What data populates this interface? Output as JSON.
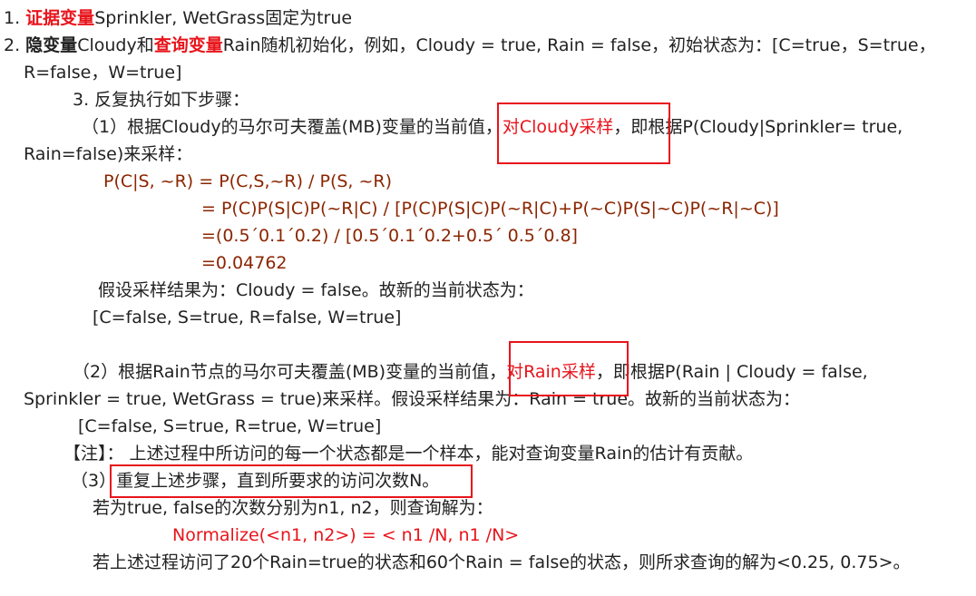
{
  "item1": {
    "num": "1. ",
    "label": "证据变量",
    "text": "Sprinkler, WetGrass固定为true"
  },
  "item2": {
    "num": "2. ",
    "label1": "隐变量",
    "mid": "Cloudy和",
    "label2": "查询变量",
    "text": "Rain随机初始化，例如，Cloudy = true, Rain = false，初始状态为：[C=true，S=true，",
    "cont": "R=false，W=true]"
  },
  "step3": "3. 反复执行如下步骤：",
  "sub1": {
    "prefix": "（1）根据Cloudy的马尔可夫覆盖(MB)变量的当前值，",
    "highlight": "对Cloudy采样",
    "suffix": "，即根据P(Cloudy|Sprinkler= true,",
    "cont": "Rain=false)来采样："
  },
  "formula": {
    "line1": "P(C|S, ~R) = P(C,S,~R) / P(S, ~R)",
    "line2": "= P(C)P(S|C)P(~R|C) / [P(C)P(S|C)P(~R|C)+P(~C)P(S|~C)P(~R|~C)]",
    "line3": "=(0.5´0.1´0.2) / [0.5´0.1´0.2+0.5´ 0.5´0.8]",
    "line4": "=0.04762"
  },
  "assume1": "假设采样结果为：Cloudy = false。故新的当前状态为：",
  "state1": "[C=false, S=true, R=false, W=true]",
  "sub2": {
    "prefix": "（2）根据Rain节点的马尔可夫覆盖(MB)变量的当前值，",
    "highlight": "对Rain采样",
    "suffix": "，即根据P(Rain | Cloudy = false,",
    "cont": "Sprinkler = true, WetGrass = true)来采样。假设采样结果为：Rain = true。故新的当前状态为："
  },
  "state2": "[C=false, S=true, R=true, W=true]",
  "note": "【注】：  上述过程中所访问的每一个状态都是一个样本，能对查询变量Rain的估计有贡献。",
  "sub3": "（3）重复上述步骤，直到所要求的访问次数N。",
  "counts": "若为true, false的次数分别为n1, n2，则查询解为：",
  "normalize": "Normalize(<n1, n2>) = < n1 /N, n1 /N>",
  "conclusion": "若上述过程访问了20个Rain=true的状态和60个Rain = false的状态，则所求查询的解为<0.25, 0.75>。"
}
